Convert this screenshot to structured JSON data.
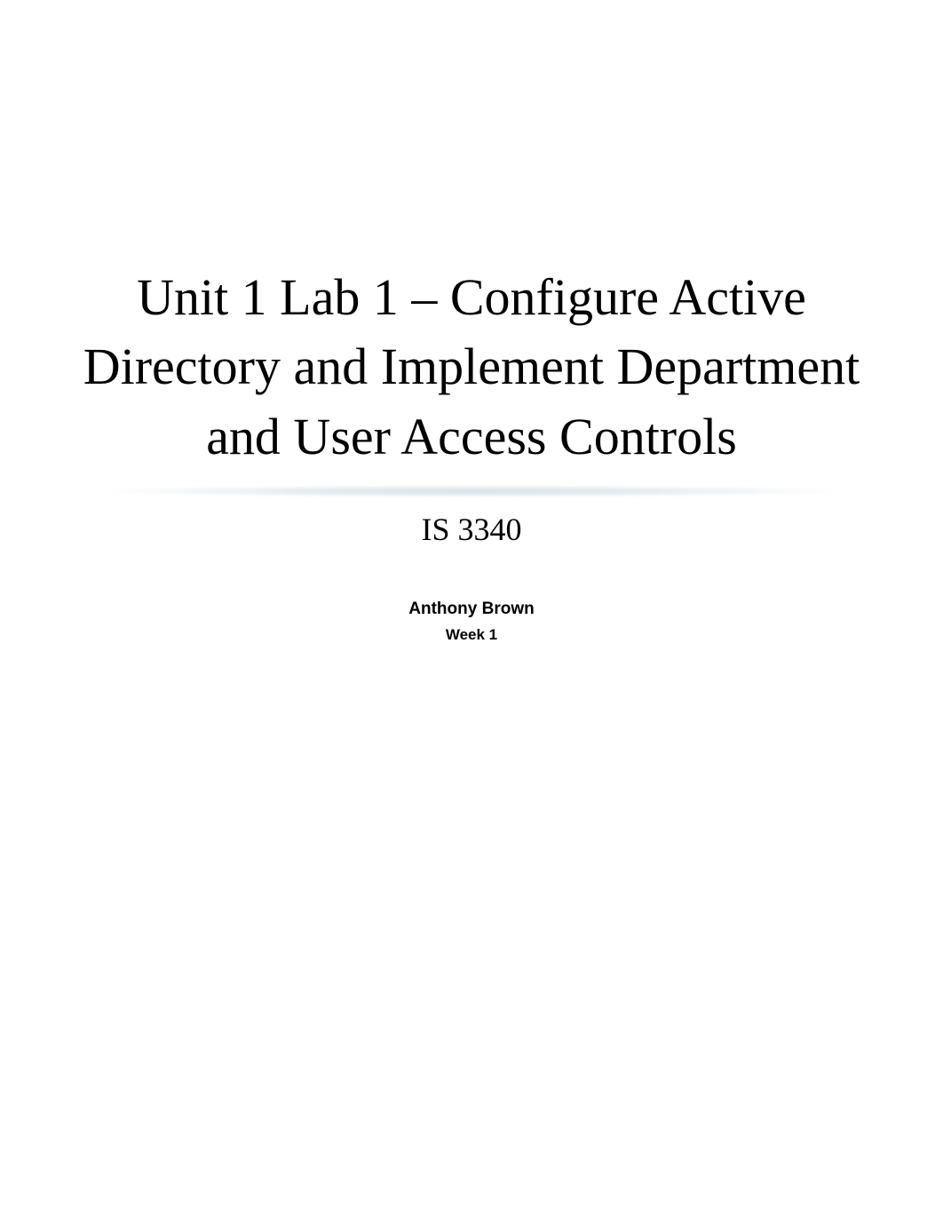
{
  "document": {
    "title": "Unit 1 Lab 1 – Configure Active Directory and Implement Department and User Access Controls",
    "subtitle": "IS 3340",
    "author": "Anthony Brown",
    "week": "Week 1"
  }
}
